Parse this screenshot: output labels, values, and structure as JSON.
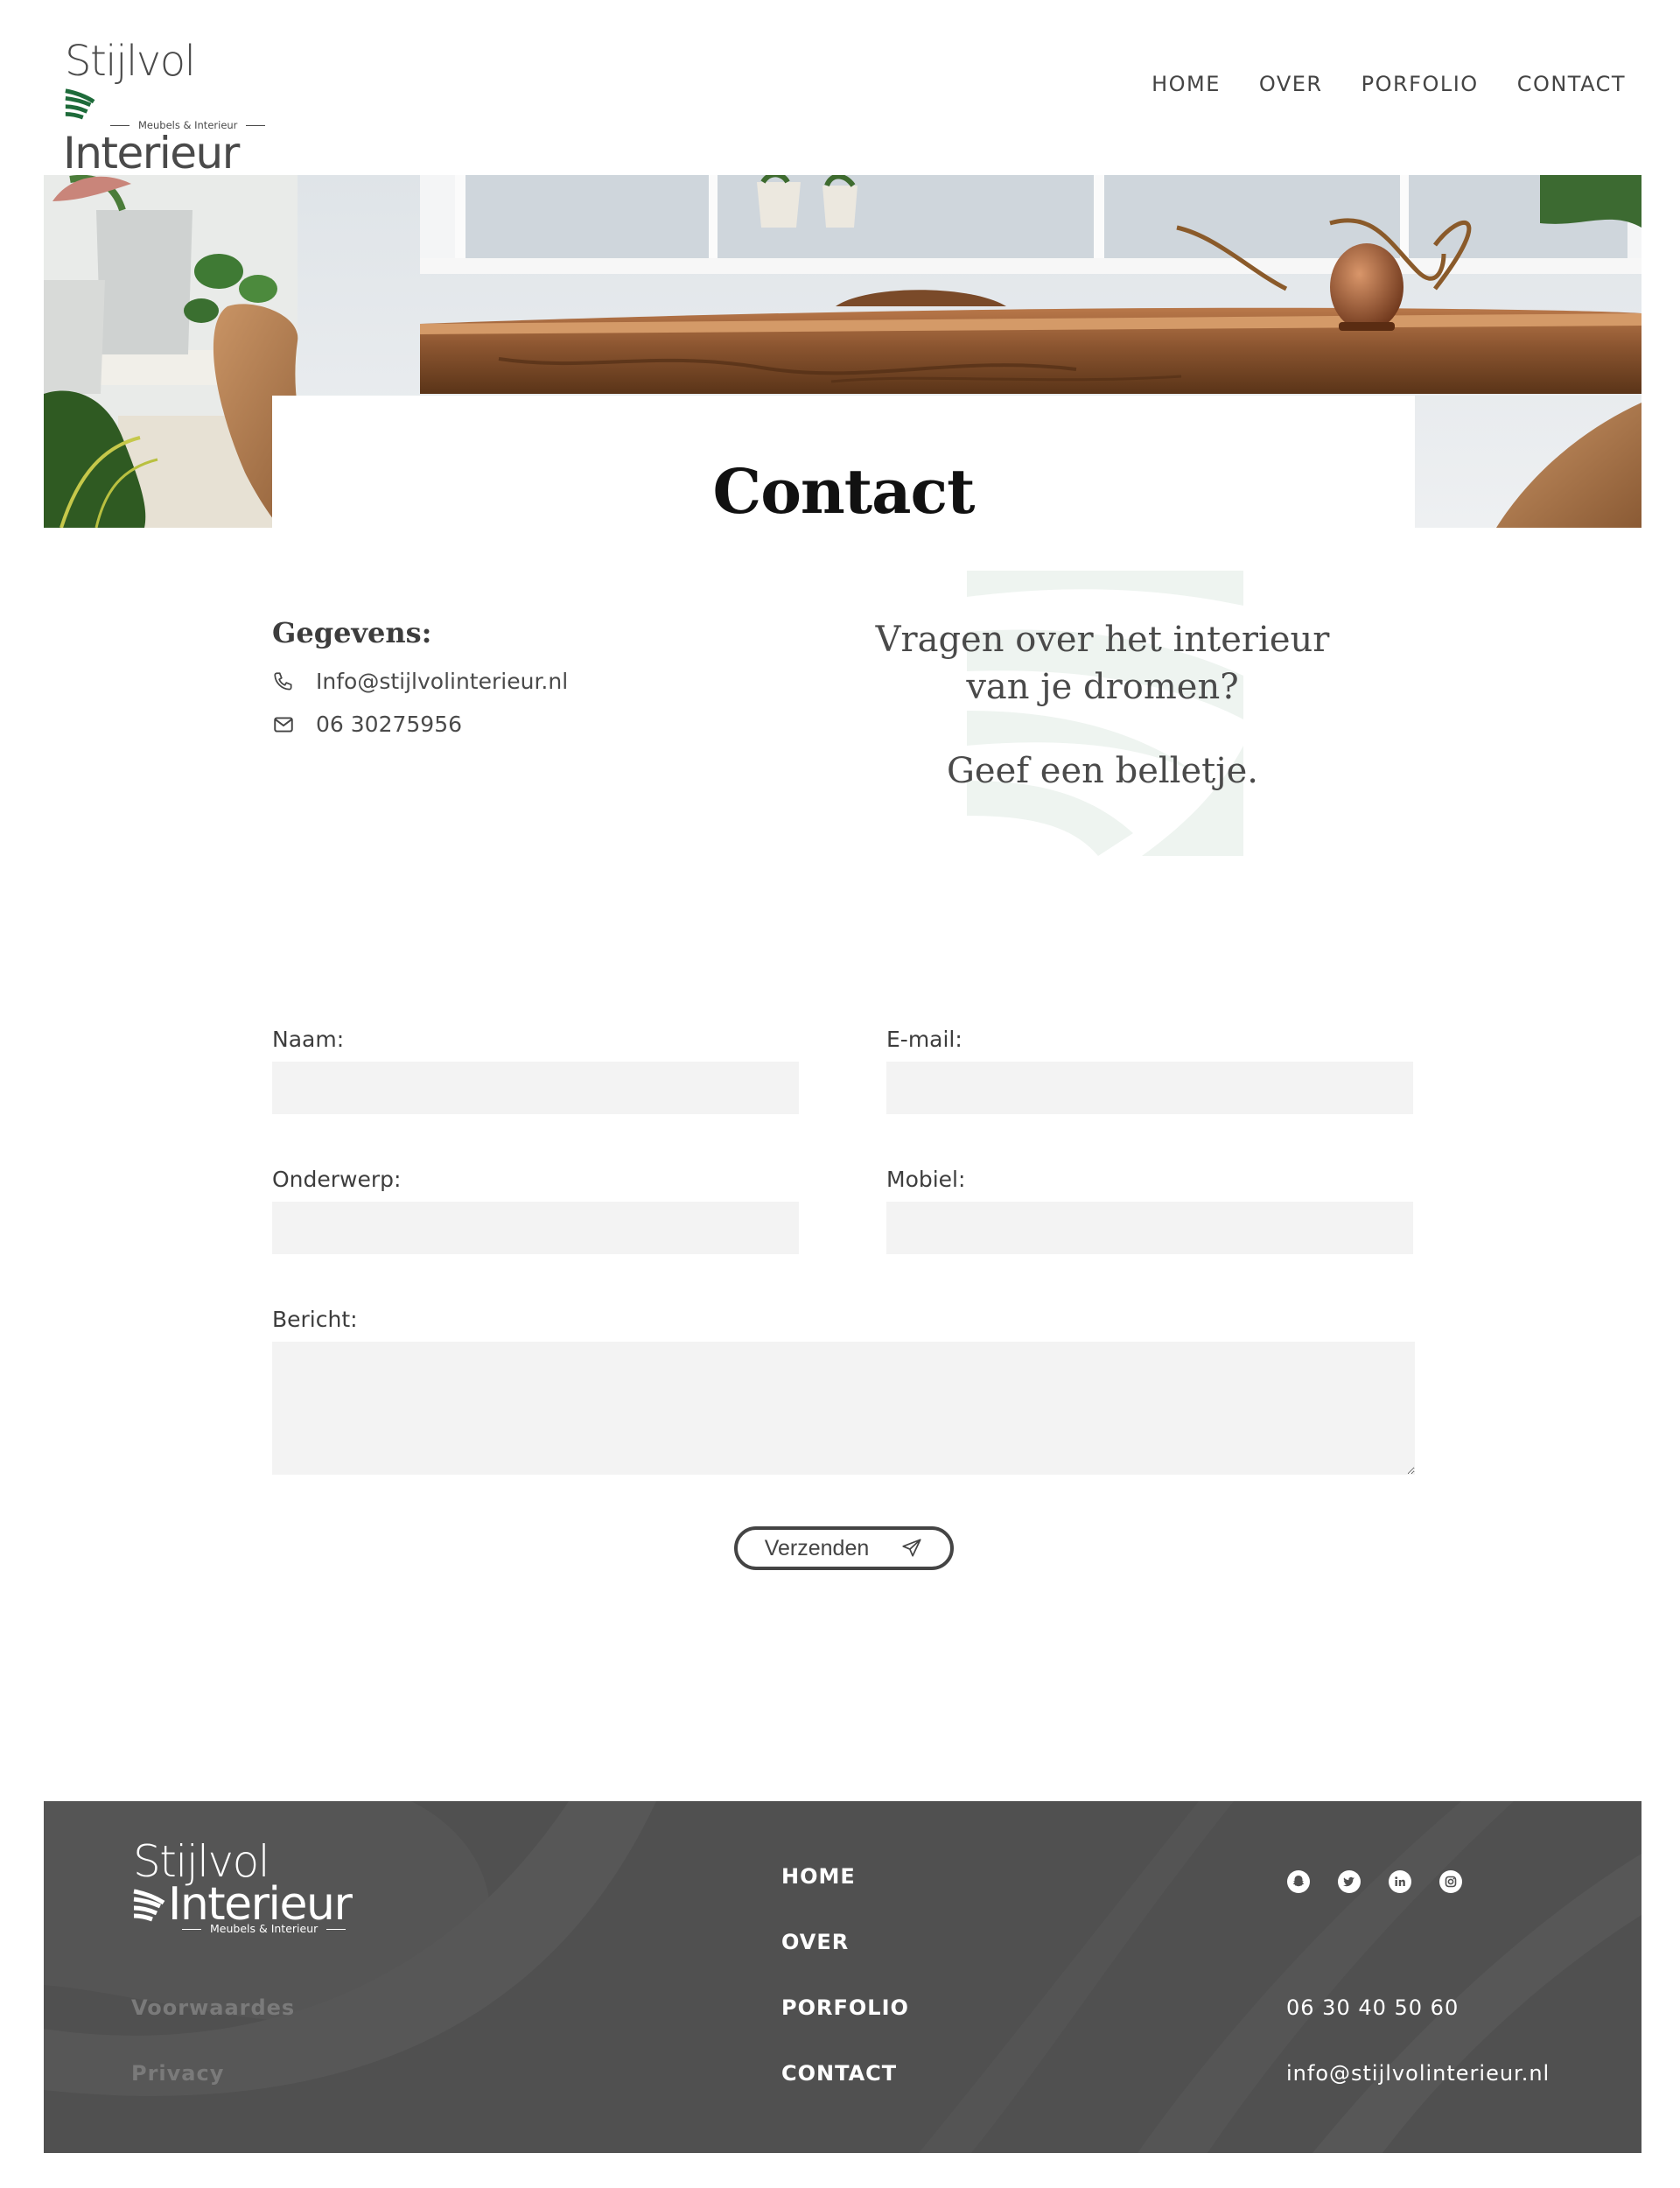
{
  "brand": {
    "name_line1": "Stijlvol",
    "name_line2": "Interieur",
    "tagline": "Meubels & Interieur"
  },
  "nav": {
    "items": [
      "HOME",
      "OVER",
      "PORFOLIO",
      "CONTACT"
    ]
  },
  "hero": {
    "title": "Contact"
  },
  "info": {
    "title": "Gegevens:",
    "email": "Info@stijlvolinterieur.nl",
    "phone": "06 30275956"
  },
  "quote": {
    "line1": "Vragen over het interieur van je dromen?",
    "line2": "Geef een belletje."
  },
  "form": {
    "name_label": "Naam:",
    "email_label": "E-mail:",
    "subject_label": "Onderwerp:",
    "mobile_label": "Mobiel:",
    "message_label": "Bericht:",
    "submit_label": "Verzenden"
  },
  "footer": {
    "links_left": [
      "Voorwaardes",
      "Privacy"
    ],
    "nav_items": [
      "HOME",
      "OVER",
      "PORFOLIO",
      "CONTACT"
    ],
    "phone": "06 30 40 50 60",
    "email": "info@stijlvolinterieur.nl",
    "social_icons": [
      "snapchat-icon",
      "twitter-icon",
      "linkedin-icon",
      "instagram-icon"
    ]
  },
  "colors": {
    "brand_green": "#1e6b3a",
    "footer_bg": "#505050",
    "field_bg": "#f3f3f3"
  }
}
